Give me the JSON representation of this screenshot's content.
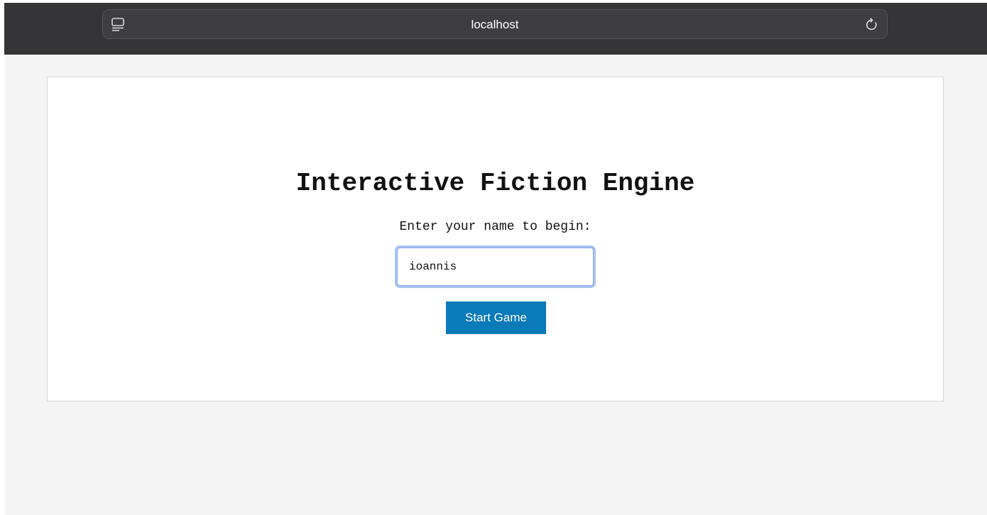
{
  "browser": {
    "url_text": "localhost",
    "icons": {
      "reader": "reader-view-icon",
      "reload": "reload-icon"
    },
    "colors": {
      "toolbar": "#353437",
      "address_bar": "#3e3d41"
    }
  },
  "page": {
    "title": "Interactive Fiction Engine",
    "prompt": "Enter your name to begin:",
    "name_input": {
      "value": "ioannis",
      "placeholder": ""
    },
    "start_button_label": "Start Game",
    "colors": {
      "button": "#0a7ab8",
      "background": "#f4f4f4",
      "focus_ring": "#a9c3f5"
    }
  }
}
